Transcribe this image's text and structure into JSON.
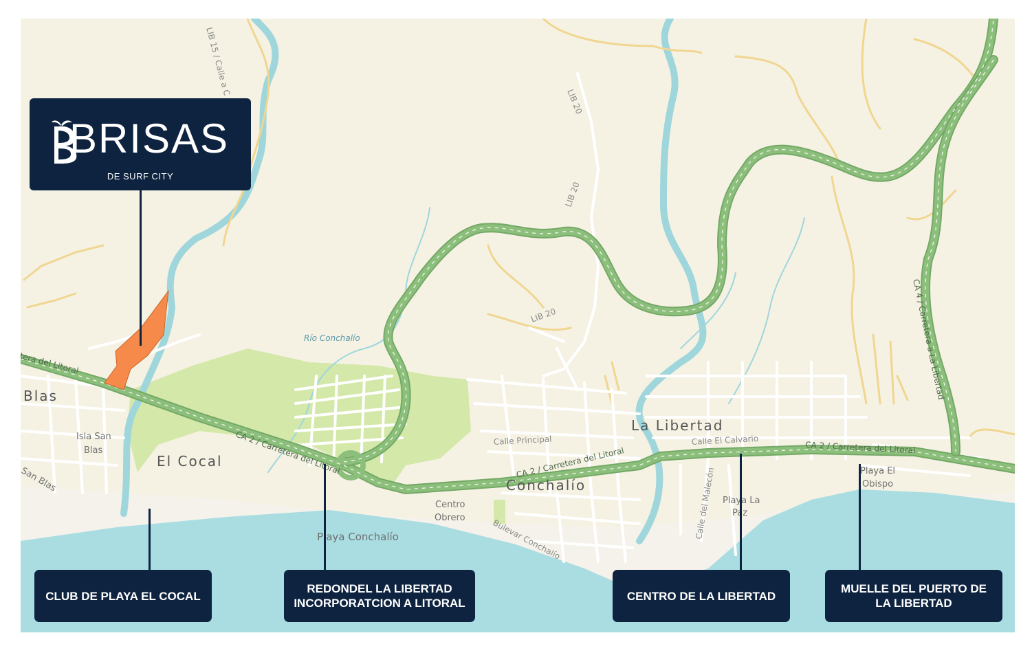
{
  "brand": {
    "name": "BRISAS",
    "tagline": "DE SURF CITY"
  },
  "colors": {
    "land": "#f5f2e4",
    "sea": "#a9dde2",
    "beach": "#f4f2ea",
    "park": "#d3e8a9",
    "highway": "#8cbf7c",
    "highway_edge": "#74a866",
    "river": "#9fd6dc",
    "minor_road": "#ffffff",
    "yellow_road": "#f0d690",
    "property": "#f58a4b",
    "callout_bg": "#0e2340",
    "callout_text": "#ffffff"
  },
  "callouts": [
    {
      "id": "cocal",
      "label": "CLUB DE PLAYA EL COCAL"
    },
    {
      "id": "redondel",
      "label": "REDONDEL LA LIBERTAD INCORPORATCION A LITORAL"
    },
    {
      "id": "centro",
      "label": "CENTRO DE LA LIBERTAD"
    },
    {
      "id": "muelle",
      "label": "MUELLE DEL PUERTO DE LA LIBERTAD"
    }
  ],
  "map_labels": {
    "places": {
      "blas": "Blas",
      "isla_san_blas_1": "Isla San",
      "isla_san_blas_2": "Blas",
      "san_blas": "San Blas",
      "el_cocal": "El Cocal",
      "conchalio": "Conchalío",
      "la_libertad": "La Libertad",
      "centro_obrero_1": "Centro",
      "centro_obrero_2": "Obrero",
      "playa_conchalio": "Playa Conchalío",
      "playa_la_paz_1": "Playa La",
      "playa_la_paz_2": "Paz",
      "playa_el_obispo_1": "Playa El",
      "playa_el_obispo_2": "Obispo"
    },
    "roads": {
      "litoral_west": "tera del Litoral",
      "ca2_west": "CA 2 / Carretera del Litoral",
      "ca2_middle": "CA 2 / Carretera del Litoral",
      "ca2_east": "CA 2 / Carretera del Litoral",
      "ca4": "CA 4 / Carretera a La Libertad",
      "lib15": "LIB 15 / Calle a C",
      "lib20_north": "LIB 20",
      "lib20_mid": "LIB 20",
      "lib20_south": "LIB 20",
      "calle_principal": "Calle Principal",
      "calle_el_calvario": "Calle El Calvario",
      "calle_del_malecon": "Calle del Malecón",
      "bulevar_conchalio": "Bulevar Conchalío"
    },
    "rivers": {
      "rio_conchalio": "Río Conchalío"
    }
  }
}
